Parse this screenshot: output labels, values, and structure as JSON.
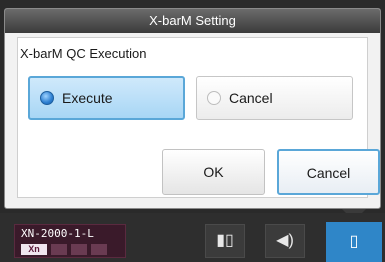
{
  "dialog": {
    "title": "X-barM Setting",
    "section_label": "X-barM QC Execution",
    "options": [
      {
        "label": "Execute",
        "selected": true
      },
      {
        "label": "Cancel",
        "selected": false
      }
    ],
    "buttons": {
      "ok_label": "OK",
      "cancel_label": "Cancel"
    }
  },
  "taskbar": {
    "device_name": "XN-2000-1-L",
    "device_mode": "Xn",
    "icons": [
      {
        "name": "analyzer-status-icon",
        "glyph": "▮▯"
      },
      {
        "name": "speaker-icon",
        "glyph": "◀)"
      },
      {
        "name": "document-icon",
        "glyph": "▯"
      }
    ]
  },
  "colors": {
    "accent_blue": "#2f86c8",
    "selected_border": "#5aa7d8",
    "device_bg": "#3a1a2a"
  }
}
